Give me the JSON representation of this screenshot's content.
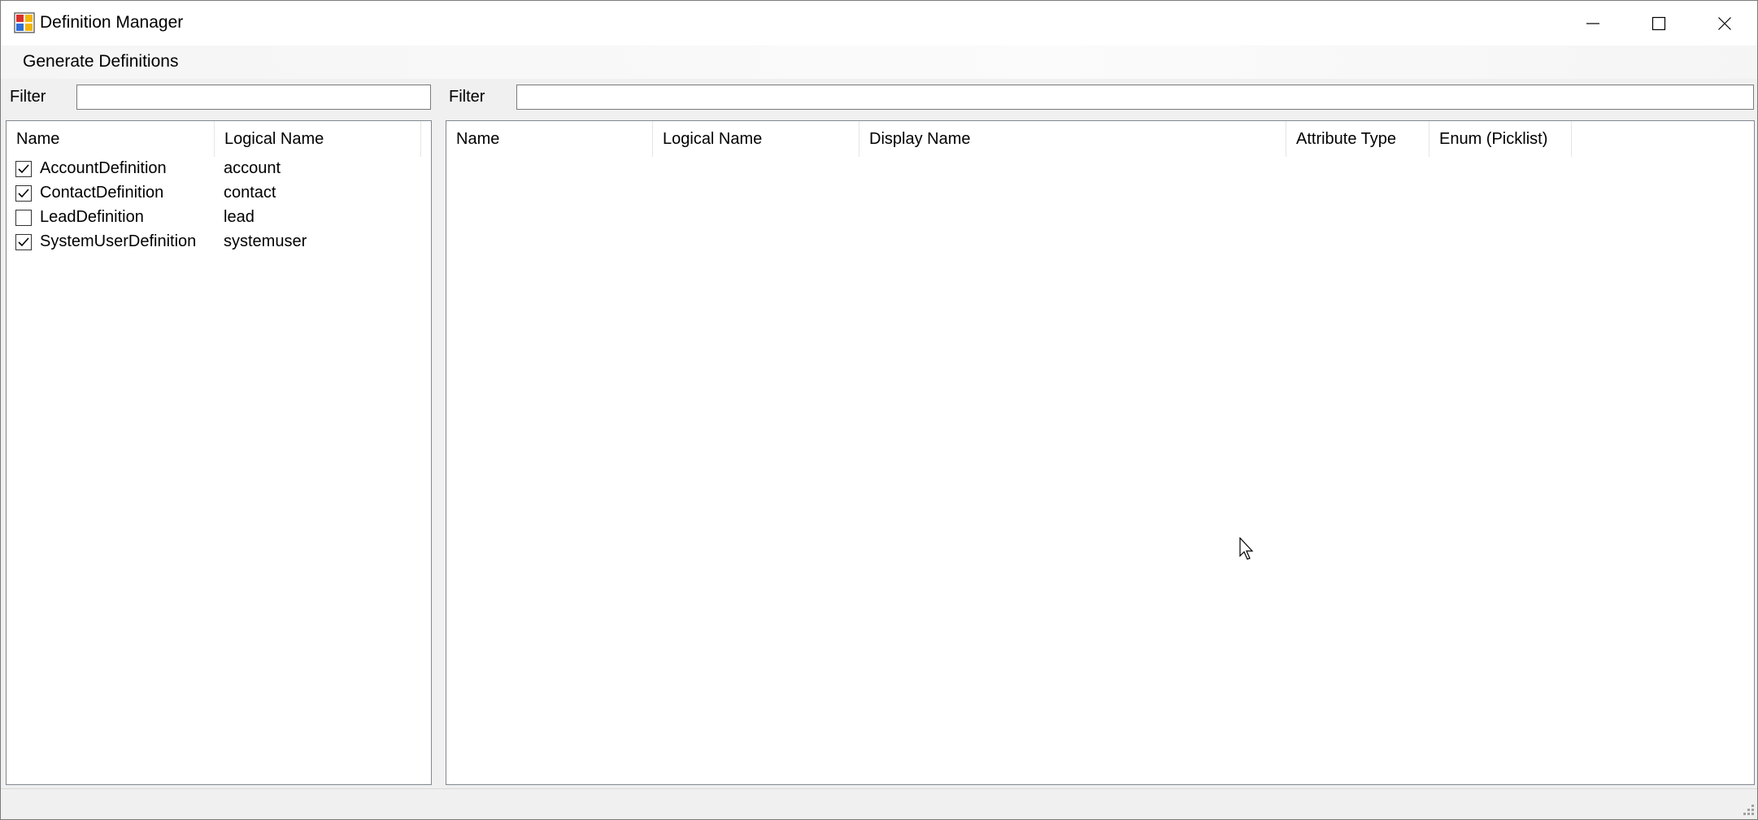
{
  "window": {
    "title": "Definition Manager",
    "app_icon": "app-icon"
  },
  "menu": {
    "generate_definitions": "Generate Definitions"
  },
  "left_panel": {
    "filter_label": "Filter",
    "filter_value": "",
    "columns": [
      "Name",
      "Logical Name"
    ],
    "rows": [
      {
        "checked": true,
        "name": "AccountDefinition",
        "logical_name": "account"
      },
      {
        "checked": true,
        "name": "ContactDefinition",
        "logical_name": "contact"
      },
      {
        "checked": false,
        "name": "LeadDefinition",
        "logical_name": "lead"
      },
      {
        "checked": true,
        "name": "SystemUserDefinition",
        "logical_name": "systemuser"
      }
    ]
  },
  "right_panel": {
    "filter_label": "Filter",
    "filter_value": "",
    "columns": [
      "Name",
      "Logical Name",
      "Display Name",
      "Attribute Type",
      "Enum (Picklist)"
    ]
  }
}
